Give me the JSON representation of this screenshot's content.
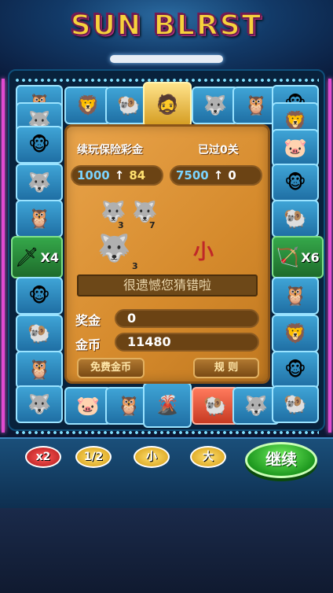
{
  "title": "SUN BLRST",
  "board": {
    "continue_label": "续玩保险彩金",
    "passed_label": "已过0关",
    "pill_left": {
      "a": "1000",
      "b": "84"
    },
    "pill_right": {
      "a": "7500",
      "b": "0"
    },
    "mini_counts": [
      "3",
      "7",
      "3"
    ],
    "result": "小",
    "message": "很遗憾您猜错啦",
    "bonus_label": "奖金",
    "bonus_value": "0",
    "coins_label": "金币",
    "coins_value": "11480",
    "free_coins_btn": "免费金币",
    "rules_btn": "规 则"
  },
  "tiles": {
    "left_mult": "X4",
    "right_mult": "X6"
  },
  "controls": {
    "x2": "x2",
    "half": "1/2",
    "small": "小",
    "big": "大",
    "continue": "继续"
  },
  "icons": {
    "lion": "lion-icon",
    "ram": "ram-icon",
    "wolf": "wolf-icon",
    "owl": "owl-icon",
    "monkey": "monkey-icon",
    "pig": "pig-icon",
    "hero": "hero-icon",
    "volcano": "volcano-icon",
    "sword": "sword-icon",
    "bow": "bow-icon"
  }
}
